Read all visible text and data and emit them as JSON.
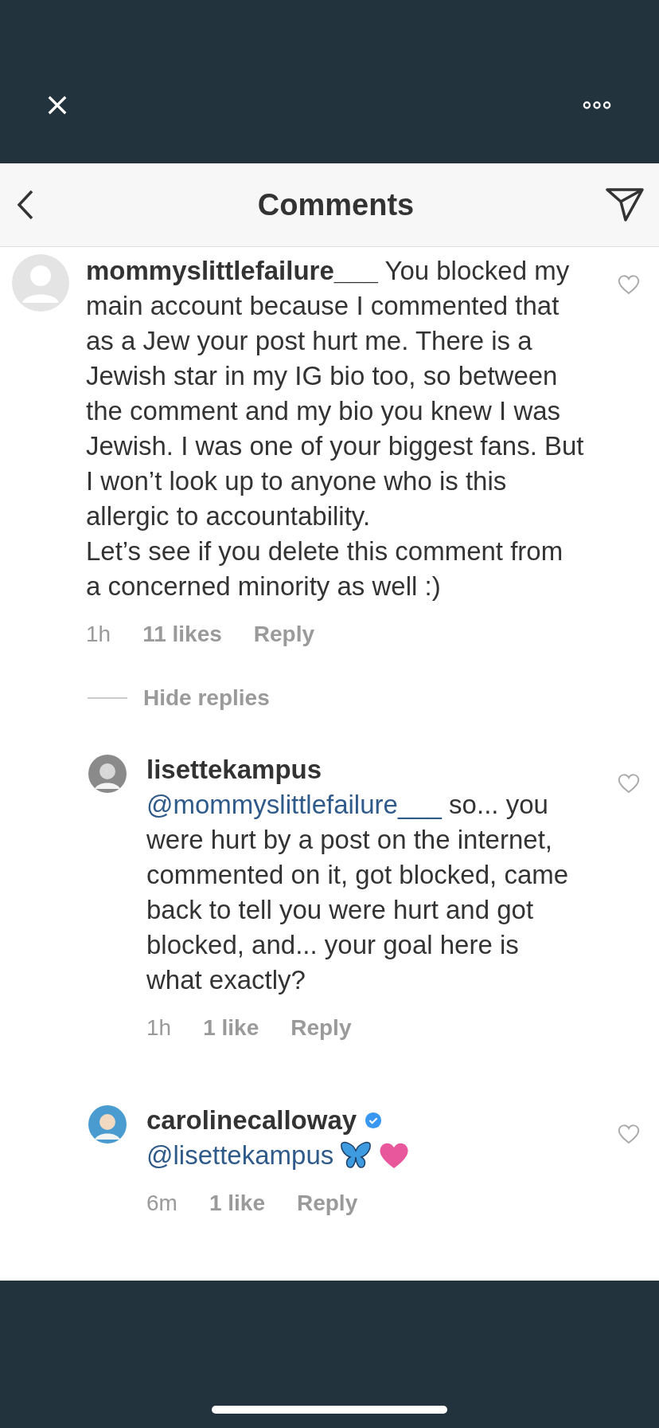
{
  "header": {
    "title": "Comments"
  },
  "comments": [
    {
      "username": "mommyslittlefailure___",
      "text": "You blocked my main account because I commented that as a Jew your post hurt me. There is a Jewish star in my IG bio too, so between the comment and my bio you knew I was Jewish. I was one of your biggest fans. But I won’t look up to anyone who is this allergic to accountability.\nLet’s see if you delete this comment from a concerned minority as well :)",
      "time": "1h",
      "likes": "11 likes",
      "reply": "Reply",
      "hide_replies": "Hide replies",
      "replies": [
        {
          "username": "lisettekampus",
          "verified": false,
          "mention": "@mommyslittlefailure___",
          "text": "so... you were hurt by a post on the internet, commented on it, got blocked, came back to tell you were hurt and got blocked, and... your goal here is what exactly?",
          "time": "1h",
          "likes": "1 like",
          "reply": "Reply",
          "emoji": false
        },
        {
          "username": "carolinecalloway",
          "verified": true,
          "mention": "@lisettekampus",
          "time": "6m",
          "likes": "1 like",
          "reply": "Reply",
          "emoji": true
        }
      ]
    }
  ]
}
